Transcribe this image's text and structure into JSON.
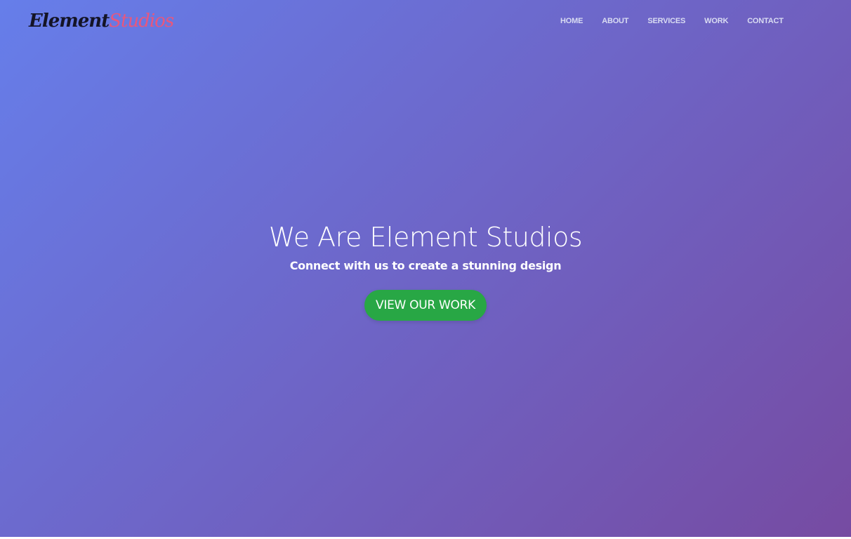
{
  "brand": {
    "logo_part_1": "Element",
    "logo_part_2": "Studios"
  },
  "nav": {
    "items": [
      {
        "label": "HOME"
      },
      {
        "label": "ABOUT"
      },
      {
        "label": "SERVICES"
      },
      {
        "label": "WORK"
      },
      {
        "label": "CONTACT"
      }
    ]
  },
  "hero": {
    "title": "We Are Element Studios",
    "subtitle": "Connect with us to create a stunning design",
    "cta_label": "VIEW OUR WORK"
  },
  "colors": {
    "gradient_start": "#667eea",
    "gradient_end": "#764ba2",
    "logo_dark": "#141426",
    "logo_accent": "#e8577d",
    "cta_green": "#28a745"
  }
}
